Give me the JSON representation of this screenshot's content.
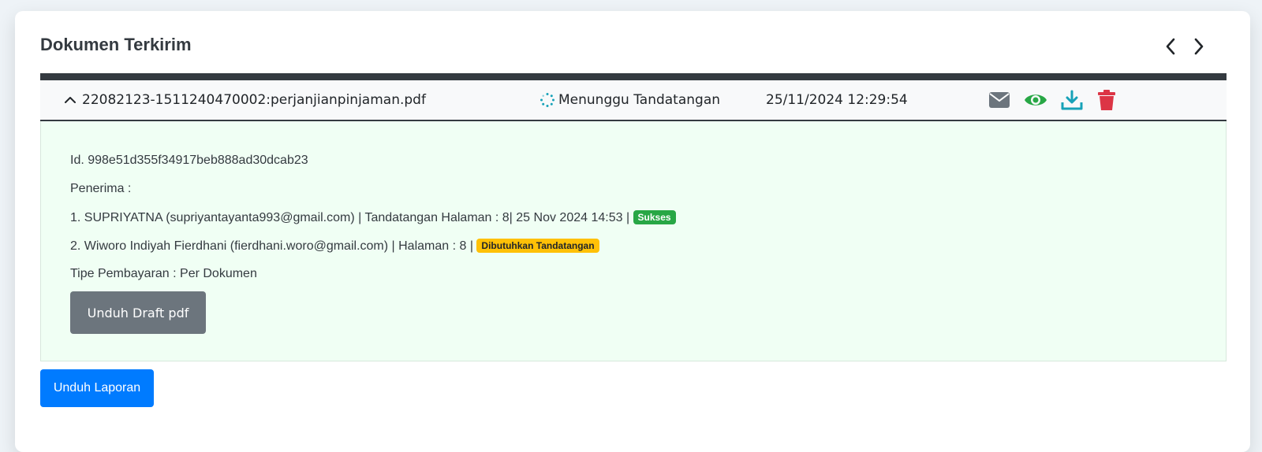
{
  "card": {
    "title": "Dokumen Terkirim"
  },
  "nav": {
    "prev_icon": "chevron-left-icon",
    "next_icon": "chevron-right-icon"
  },
  "document": {
    "filename": "22082123-1511240470002:perjanjianpinjaman.pdf",
    "status": "Menunggu Tandatangan",
    "status_icon": "spinner-icon",
    "datetime": "25/11/2024 12:29:54",
    "actions": [
      {
        "icon": "envelope-icon",
        "color": "#6c757d"
      },
      {
        "icon": "eye-icon",
        "color": "#28a745"
      },
      {
        "icon": "download-icon",
        "color": "#17a2b8"
      },
      {
        "icon": "trash-icon",
        "color": "#dc3545"
      }
    ]
  },
  "details": {
    "id_line": "Id. 998e51d355f34917beb888ad30dcab23",
    "recipients_label": "Penerima :",
    "recipients": [
      {
        "text": "1. SUPRIYATNA (supriyantayanta993@gmail.com) | Tandatangan Halaman : 8| 25 Nov 2024 14:53 | ",
        "badge": "Sukses",
        "badge_color": "#28a745"
      },
      {
        "text": "2. Wiworo Indiyah Fierdhani (fierdhani.woro@gmail.com) | Halaman : 8 | ",
        "badge": "Dibutuhkan Tandatangan",
        "badge_color": "#ffc107"
      }
    ],
    "payment_type": "Tipe Pembayaran : Per Dokumen",
    "draft_button": "Unduh Draft pdf"
  },
  "report_button": "Unduh Laporan",
  "colors": {
    "accent": "#007bff",
    "success": "#28a745",
    "warning": "#ffc107",
    "danger": "#dc3545",
    "info": "#17a2b8",
    "detail_bg": "#f0fff4"
  }
}
